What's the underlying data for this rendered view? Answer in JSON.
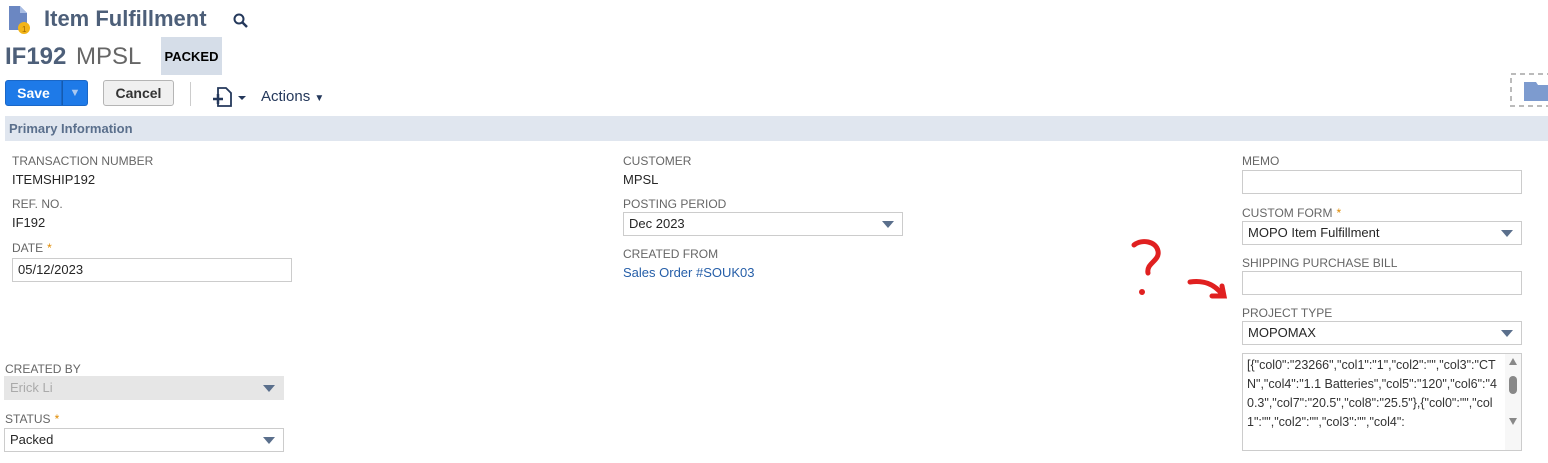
{
  "header": {
    "title": "Item Fulfillment",
    "record_id": "IF192",
    "record_name": "MPSL",
    "status_badge": "PACKED"
  },
  "toolbar": {
    "save_label": "Save",
    "cancel_label": "Cancel",
    "actions_label": "Actions"
  },
  "section": {
    "title": "Primary Information"
  },
  "fields": {
    "transaction_number": {
      "label": "TRANSACTION NUMBER",
      "value": "ITEMSHIP192"
    },
    "ref_no": {
      "label": "REF. NO.",
      "value": "IF192"
    },
    "date": {
      "label": "DATE",
      "value": "05/12/2023"
    },
    "customer": {
      "label": "CUSTOMER",
      "value": "MPSL"
    },
    "posting_period": {
      "label": "POSTING PERIOD",
      "value": "Dec 2023"
    },
    "created_from": {
      "label": "CREATED FROM",
      "value": "Sales Order #SOUK03"
    },
    "memo": {
      "label": "MEMO",
      "value": ""
    },
    "custom_form": {
      "label": "CUSTOM FORM",
      "value": "MOPO Item Fulfillment"
    },
    "shipping_purchase_bill": {
      "label": "SHIPPING PURCHASE BILL",
      "value": ""
    },
    "project_type": {
      "label": "PROJECT TYPE",
      "value": "MOPOMAX"
    },
    "json_field": {
      "value": "[{\"col0\":\"23266\",\"col1\":\"1\",\"col2\":\"\",\"col3\":\"CTN\",\"col4\":\"1.1 Batteries\",\"col5\":\"120\",\"col6\":\"40.3\",\"col7\":\"20.5\",\"col8\":\"25.5\"},{\"col0\":\"\",\"col1\":\"\",\"col2\":\"\",\"col3\":\"\",\"col4\":"
    },
    "created_by": {
      "label": "CREATED BY",
      "value": "Erick Li"
    },
    "status": {
      "label": "STATUS",
      "value": "Packed"
    }
  },
  "required_mark": "*",
  "annotation": {
    "mark": "?"
  }
}
